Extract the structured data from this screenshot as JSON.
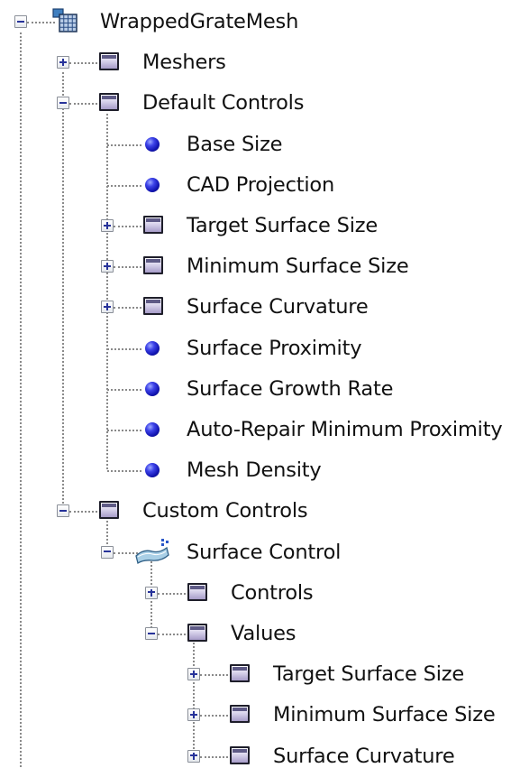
{
  "tree": {
    "nodes": [
      {
        "id": "root",
        "label": "WrappedGrateMesh",
        "icon": "mesh-icon",
        "level": 0,
        "toggle": "minus"
      },
      {
        "id": "meshers",
        "label": "Meshers",
        "icon": "folder-icon",
        "level": 1,
        "toggle": "plus"
      },
      {
        "id": "default-controls",
        "label": "Default Controls",
        "icon": "folder-icon",
        "level": 1,
        "toggle": "minus"
      },
      {
        "id": "base-size",
        "label": "Base Size",
        "icon": "bullet-icon",
        "level": 2,
        "toggle": "none"
      },
      {
        "id": "cad-projection",
        "label": "CAD Projection",
        "icon": "bullet-icon",
        "level": 2,
        "toggle": "none"
      },
      {
        "id": "target-surface-size",
        "label": "Target Surface Size",
        "icon": "folder-icon",
        "level": 2,
        "toggle": "plus"
      },
      {
        "id": "minimum-surface-size",
        "label": "Minimum Surface Size",
        "icon": "folder-icon",
        "level": 2,
        "toggle": "plus"
      },
      {
        "id": "surface-curvature",
        "label": "Surface Curvature",
        "icon": "folder-icon",
        "level": 2,
        "toggle": "plus"
      },
      {
        "id": "surface-proximity",
        "label": "Surface Proximity",
        "icon": "bullet-icon",
        "level": 2,
        "toggle": "none"
      },
      {
        "id": "surface-growth-rate",
        "label": "Surface Growth Rate",
        "icon": "bullet-icon",
        "level": 2,
        "toggle": "none"
      },
      {
        "id": "auto-repair-minimum-proximity",
        "label": "Auto-Repair Minimum Proximity",
        "icon": "bullet-icon",
        "level": 2,
        "toggle": "none"
      },
      {
        "id": "mesh-density",
        "label": "Mesh Density",
        "icon": "bullet-icon",
        "level": 2,
        "toggle": "none"
      },
      {
        "id": "custom-controls",
        "label": "Custom Controls",
        "icon": "folder-icon",
        "level": 1,
        "toggle": "minus"
      },
      {
        "id": "surface-control",
        "label": "Surface Control",
        "icon": "surface-control-icon",
        "level": 2,
        "toggle": "minus"
      },
      {
        "id": "controls",
        "label": "Controls",
        "icon": "folder-icon",
        "level": 3,
        "toggle": "plus"
      },
      {
        "id": "values",
        "label": "Values",
        "icon": "folder-icon",
        "level": 3,
        "toggle": "minus"
      },
      {
        "id": "values-target-surface-size",
        "label": "Target Surface Size",
        "icon": "folder-icon",
        "level": 4,
        "toggle": "plus"
      },
      {
        "id": "values-minimum-surface-size",
        "label": "Minimum Surface Size",
        "icon": "folder-icon",
        "level": 4,
        "toggle": "plus"
      },
      {
        "id": "values-surface-curvature",
        "label": "Surface Curvature",
        "icon": "folder-icon",
        "level": 4,
        "toggle": "plus"
      }
    ]
  },
  "colors": {
    "background": "#ffffff",
    "text": "#111111",
    "connector": "#8a8a8a",
    "toggle_sign": "#27339a",
    "bullet": "#1a1fd0",
    "folder_fill": "#cfc8ea",
    "folder_outline": "#1e1e2a"
  }
}
